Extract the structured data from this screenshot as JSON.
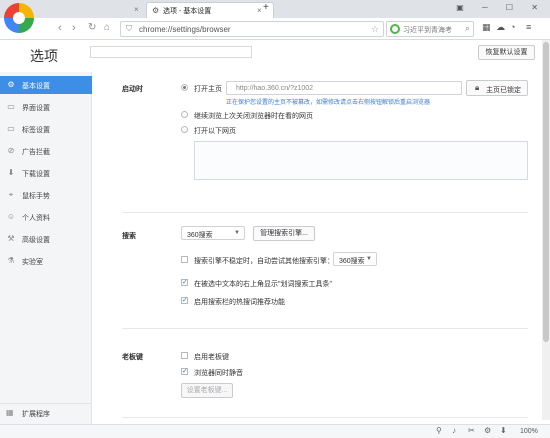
{
  "browser": {
    "tab_title": "选项 - 基本设置",
    "new_tab": "+",
    "tab_close": "×",
    "url": "chrome://settings/browser",
    "search_placeholder": "习近平到青海考",
    "window_controls": "▣ ─ ☐ ✕"
  },
  "header": {
    "title": "选项",
    "search_placeholder": "",
    "reset_label": "恢复默认设置"
  },
  "sidebar": {
    "items": [
      {
        "label": "基本设置",
        "icon": "gear-icon",
        "glyph": "⚙"
      },
      {
        "label": "界面设置",
        "icon": "window-icon",
        "glyph": "▭"
      },
      {
        "label": "标签设置",
        "icon": "tab-icon",
        "glyph": "▭"
      },
      {
        "label": "广告拦截",
        "icon": "block-icon",
        "glyph": "⊘"
      },
      {
        "label": "下载设置",
        "icon": "download-icon",
        "glyph": "⬇"
      },
      {
        "label": "鼠标手势",
        "icon": "mouse-icon",
        "glyph": "⌖"
      },
      {
        "label": "个人资料",
        "icon": "person-icon",
        "glyph": "☺"
      },
      {
        "label": "高级设置",
        "icon": "advanced-icon",
        "glyph": "⚒"
      },
      {
        "label": "实验室",
        "icon": "lab-icon",
        "glyph": "⚗"
      }
    ],
    "bottom": {
      "label": "扩展程序",
      "icon": "extensions-icon",
      "glyph": "▦"
    }
  },
  "startup": {
    "label": "启动时",
    "option_homepage": "打开主页",
    "homepage_value": "http://hao.360.cn/?z1002",
    "lock_label": "主页已锁定",
    "warning": "正在保护您设置的主页不被篡改，如需修改请点击右侧按钮解锁后重启浏览器",
    "option_continue": "继续浏览上次关闭浏览器时在看的网页",
    "option_pages": "打开以下网页"
  },
  "search": {
    "label": "搜索",
    "engine": "360搜索",
    "manage_label": "管理搜索引擎...",
    "fallback_text": "搜索引擎不稳定时，自动尝试其他搜索引擎：",
    "fallback_engine": "360搜索",
    "show_toolbar_text": "在被选中文本的右上角显示\"划词搜索工具条\"",
    "hot_words_text": "启用搜索栏的热搜词推荐功能"
  },
  "boss_key": {
    "label": "老板键",
    "enable_text": "启用老板键",
    "mute_text": "浏览器同时静音",
    "set_label": "设置老板键..."
  },
  "status": {
    "zoom": "100%"
  },
  "colors": {
    "accent": "#3c8ee6",
    "sidebar_bg": "#f3f5f7",
    "link_blue": "#3a7bd5"
  }
}
